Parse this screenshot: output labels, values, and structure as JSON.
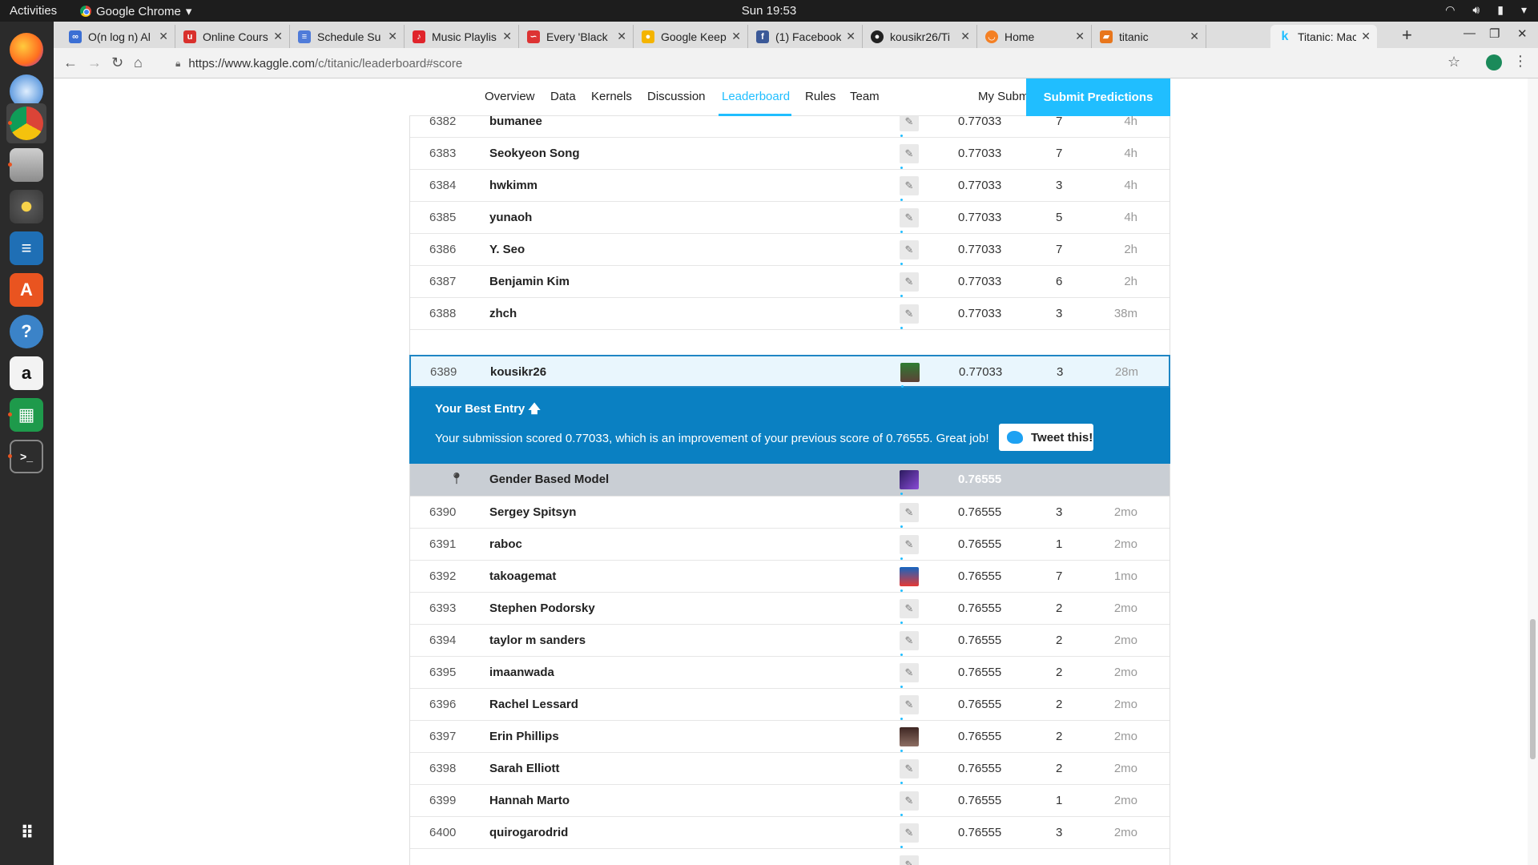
{
  "topbar": {
    "activities": "Activities",
    "app_name": "Google Chrome",
    "clock": "Sun 19:53"
  },
  "dock": {
    "items": [
      "firefox-icon",
      "thunderbird-icon",
      "chrome-icon",
      "files-icon",
      "rhythmbox-icon",
      "writer-icon",
      "software-center-icon",
      "help-icon",
      "amazon-icon",
      "calc-icon",
      "terminal-icon",
      "app-grid-icon"
    ]
  },
  "tabs": [
    {
      "label": "O(n log n) Al",
      "color": "#3b6fd4"
    },
    {
      "label": "Online Cours",
      "color": "#d9302c"
    },
    {
      "label": "Schedule Su",
      "color": "#4f7bd9"
    },
    {
      "label": "Music Playlis",
      "color": "#e0242b"
    },
    {
      "label": "Every 'Black",
      "color": "#d33"
    },
    {
      "label": "Google Keep",
      "color": "#f4b400"
    },
    {
      "label": "(1) Facebook",
      "color": "#3b5998"
    },
    {
      "label": "kousikr26/Ti",
      "color": "#222222"
    },
    {
      "label": "Home",
      "color": "#f48024"
    },
    {
      "label": "titanic",
      "color": "#e8761c"
    },
    {
      "label": "Titanic: Mac",
      "color": "#20beff"
    }
  ],
  "toolbar": {
    "url_host": "https://www.kaggle.com",
    "url_path": "/c/titanic/leaderboard#score"
  },
  "subnav": {
    "items": [
      "Overview",
      "Data",
      "Kernels",
      "Discussion",
      "Leaderboard",
      "Rules",
      "Team"
    ],
    "active": "Leaderboard",
    "my_submissions": "My Submissions",
    "submit": "Submit Predictions"
  },
  "rows_above": [
    {
      "rank": "6382",
      "name": "bumanee",
      "score": "0.77033",
      "entries": "7",
      "last": "4h"
    },
    {
      "rank": "6383",
      "name": "Seokyeon Song",
      "score": "0.77033",
      "entries": "7",
      "last": "4h"
    },
    {
      "rank": "6384",
      "name": "hwkimm",
      "score": "0.77033",
      "entries": "3",
      "last": "4h"
    },
    {
      "rank": "6385",
      "name": "yunaoh",
      "score": "0.77033",
      "entries": "5",
      "last": "4h"
    },
    {
      "rank": "6386",
      "name": "Y. Seo",
      "score": "0.77033",
      "entries": "7",
      "last": "2h"
    },
    {
      "rank": "6387",
      "name": "Benjamin Kim",
      "score": "0.77033",
      "entries": "6",
      "last": "2h"
    },
    {
      "rank": "6388",
      "name": "zhch",
      "score": "0.77033",
      "entries": "3",
      "last": "38m"
    }
  ],
  "mine": {
    "rank": "6389",
    "name": "kousikr26",
    "score": "0.77033",
    "entries": "3",
    "last": "28m"
  },
  "best_entry": {
    "title": "Your Best Entry",
    "message": "Your submission scored 0.77033, which is an improvement of your previous score of 0.76555. Great job!",
    "tweet": "Tweet this!"
  },
  "benchmark": {
    "name": "Gender Based Model",
    "score": "0.76555"
  },
  "rows_below": [
    {
      "rank": "6390",
      "name": "Sergey Spitsyn",
      "score": "0.76555",
      "entries": "3",
      "last": "2mo"
    },
    {
      "rank": "6391",
      "name": "raboc",
      "score": "0.76555",
      "entries": "1",
      "last": "2mo"
    },
    {
      "rank": "6392",
      "name": "takoagemat",
      "score": "0.76555",
      "entries": "7",
      "last": "1mo"
    },
    {
      "rank": "6393",
      "name": "Stephen Podorsky",
      "score": "0.76555",
      "entries": "2",
      "last": "2mo"
    },
    {
      "rank": "6394",
      "name": "taylor m sanders",
      "score": "0.76555",
      "entries": "2",
      "last": "2mo"
    },
    {
      "rank": "6395",
      "name": "imaanwada",
      "score": "0.76555",
      "entries": "2",
      "last": "2mo"
    },
    {
      "rank": "6396",
      "name": "Rachel Lessard",
      "score": "0.76555",
      "entries": "2",
      "last": "2mo"
    },
    {
      "rank": "6397",
      "name": "Erin Phillips",
      "score": "0.76555",
      "entries": "2",
      "last": "2mo"
    },
    {
      "rank": "6398",
      "name": "Sarah Elliott",
      "score": "0.76555",
      "entries": "2",
      "last": "2mo"
    },
    {
      "rank": "6399",
      "name": "Hannah Marto",
      "score": "0.76555",
      "entries": "1",
      "last": "2mo"
    },
    {
      "rank": "6400",
      "name": "quirogarodrid",
      "score": "0.76555",
      "entries": "3",
      "last": "2mo"
    }
  ],
  "colors": {
    "accent": "#20beff",
    "best_banner": "#0a80c2",
    "benchmark_row": "#c9ced4"
  }
}
